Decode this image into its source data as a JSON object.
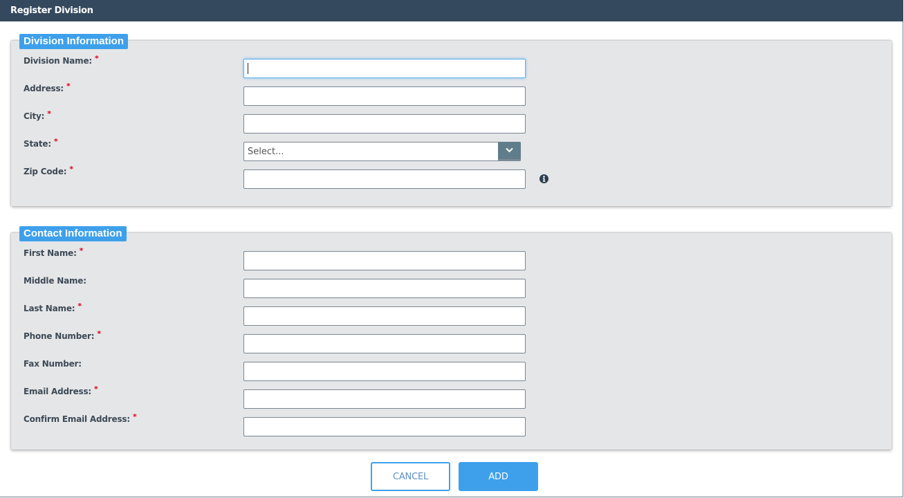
{
  "window": {
    "title": "Register Division"
  },
  "division_section": {
    "legend": "Division Information",
    "fields": [
      {
        "label": "Division Name:",
        "required": "*",
        "value": "",
        "focused": true
      },
      {
        "label": "Address:",
        "required": "*",
        "value": ""
      },
      {
        "label": "City:",
        "required": "*",
        "value": ""
      },
      {
        "label": "State:",
        "required": "*",
        "selected": "Select...",
        "type": "select"
      },
      {
        "label": "Zip Code:",
        "required": "*",
        "value": "",
        "icon": "info-icon"
      }
    ]
  },
  "contact_section": {
    "legend": "Contact Information",
    "fields": [
      {
        "label": "First Name:",
        "required": "*",
        "value": ""
      },
      {
        "label": "Middle Name:",
        "required": "",
        "value": ""
      },
      {
        "label": "Last Name:",
        "required": "*",
        "value": ""
      },
      {
        "label": "Phone Number:",
        "required": "*",
        "value": ""
      },
      {
        "label": "Fax Number:",
        "required": "",
        "value": ""
      },
      {
        "label": "Email Address:",
        "required": "*",
        "value": ""
      },
      {
        "label": "Confirm Email Address:",
        "required": "*",
        "value": ""
      }
    ]
  },
  "actions": {
    "cancel_label": "CANCEL",
    "add_label": "ADD"
  },
  "colors": {
    "titlebar": "#34495e",
    "accent": "#3ea0eb",
    "required": "#e0001b",
    "panel": "#e5e6e8"
  }
}
